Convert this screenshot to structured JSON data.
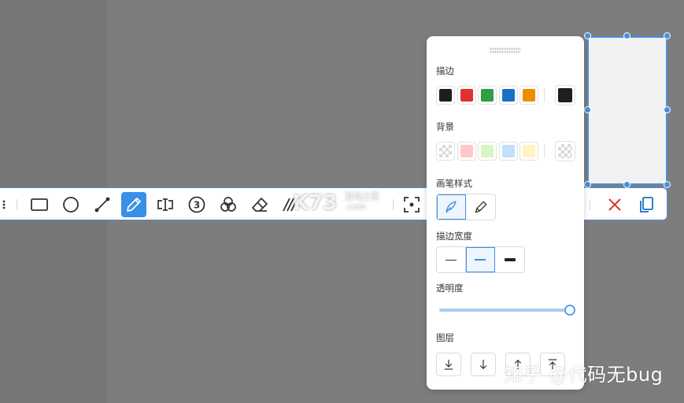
{
  "panel": {
    "stroke": {
      "label": "描边",
      "colors": [
        "#1e1e1e",
        "#e03131",
        "#2f9e44",
        "#1971c2",
        "#f08c00"
      ],
      "current": "#1e1e1e"
    },
    "background": {
      "label": "背景",
      "colors": [
        "transparent",
        "#ffc9c9",
        "#d8f5c6",
        "#c3dffa",
        "#fff3bf"
      ],
      "current": "transparent"
    },
    "pen_style": {
      "label": "画笔样式",
      "options": [
        "fine-pen-icon",
        "marker-pen-icon"
      ],
      "selected": 0
    },
    "stroke_width": {
      "label": "描边宽度",
      "options": [
        "thin",
        "medium",
        "bold"
      ],
      "selected": 1
    },
    "opacity": {
      "label": "透明度",
      "value": 100
    },
    "layers": {
      "label": "图层",
      "buttons": [
        "send-to-back-icon",
        "send-backward-icon",
        "bring-forward-icon",
        "bring-to-front-icon"
      ]
    }
  },
  "toolbar": {
    "tools": [
      "grip-icon",
      "rectangle-icon",
      "ellipse-icon",
      "line-icon",
      "pencil-icon",
      "text-icon",
      "number-icon",
      "blur-icon",
      "eraser-icon",
      "hatch-icon",
      "scan-icon",
      "cancel-icon",
      "copy-icon"
    ],
    "active": "pencil-icon",
    "accent": "#3a8fe8"
  },
  "watermarks": {
    "logo": "K73",
    "logo_sub": "游戏之家",
    "logo_sub2": ".com",
    "bottom": "知乎 @代码无bug"
  }
}
